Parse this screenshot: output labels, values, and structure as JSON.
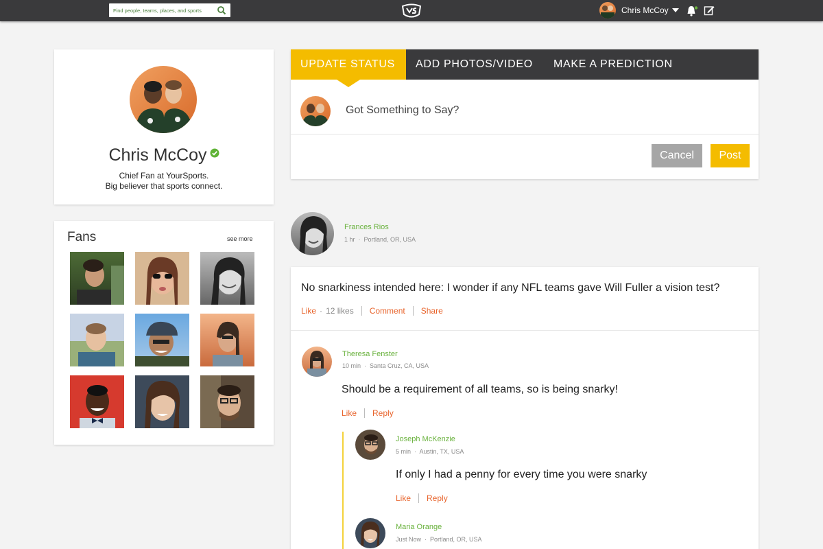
{
  "header": {
    "search_placeholder": "Find people, teams, places, and sports",
    "user_name": "Chris McCoy"
  },
  "profile": {
    "name": "Chris McCoy",
    "bio_line1": "Chief Fan at YourSports.",
    "bio_line2": "Big believer that sports connect."
  },
  "fans": {
    "title": "Fans",
    "see_more": "see more"
  },
  "composer": {
    "tabs": [
      "UPDATE STATUS",
      "ADD PHOTOS/VIDEO",
      "MAKE A PREDICTION"
    ],
    "placeholder": "Got Something to Say?",
    "cancel_label": "Cancel",
    "post_label": "Post"
  },
  "post": {
    "author": "Frances Rios",
    "time": "1 hr",
    "location": "Portland, OR, USA",
    "text": "No snarkiness intended here: I wonder if any NFL teams gave Will Fuller a vision test?",
    "like_label": "Like",
    "likes_count": "12 likes",
    "comment_label": "Comment",
    "share_label": "Share"
  },
  "comments": [
    {
      "author": "Theresa Fenster",
      "time": "10 min",
      "location": "Santa Cruz, CA, USA",
      "text": "Should be a requirement of all teams, so is being snarky!",
      "like_label": "Like",
      "reply_label": "Reply"
    },
    {
      "author": "Joseph McKenzie",
      "time": "5 min",
      "location": "Austin, TX, USA",
      "text": "If only I had a penny for every time you were snarky",
      "like_label": "Like",
      "reply_label": "Reply"
    },
    {
      "author": "Maria Orange",
      "time": "Just Now",
      "location": "Portland, OR, USA"
    }
  ],
  "colors": {
    "accent_yellow": "#f4bc00",
    "header_dark": "#3a3a3c",
    "name_green": "#6ab23e",
    "action_orange": "#e8642c"
  }
}
